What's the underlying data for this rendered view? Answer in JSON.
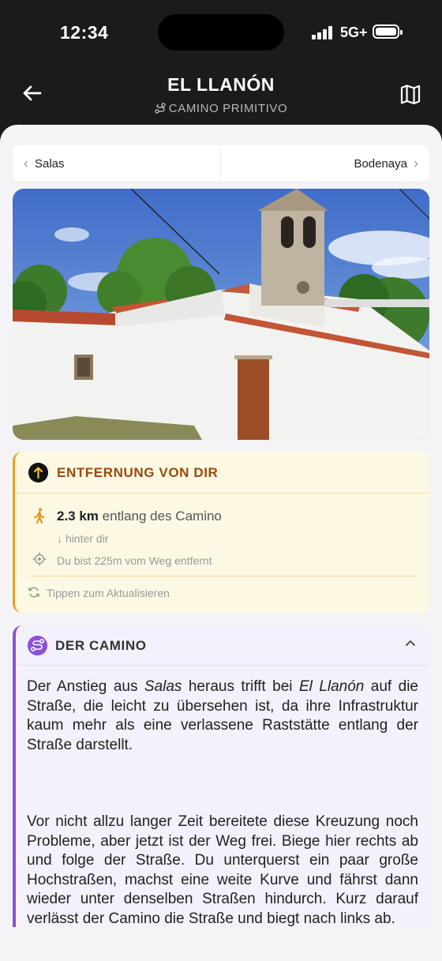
{
  "status_bar": {
    "time": "12:34",
    "network": "5G+"
  },
  "header": {
    "title": "EL LLANÓN",
    "subtitle": "CAMINO PRIMITIVO",
    "back_icon": "arrow-left-icon",
    "map_icon": "map-icon"
  },
  "nav": {
    "prev_label": "Salas",
    "next_label": "Bodenaya"
  },
  "distance_card": {
    "title": "ENTFERNUNG VON DIR",
    "distance": "2.3 km",
    "distance_suffix": "entlang des Camino",
    "direction": "↓ hinter dir",
    "off_path": "Du bist 225m vom Weg entfernt",
    "refresh": "Tippen zum Aktualisieren",
    "accent_color": "#e6a020",
    "title_color": "#9a4a0b"
  },
  "camino_card": {
    "title": "DER CAMINO",
    "accent_color": "#8a50d8",
    "paragraph1": {
      "t1": "Der Anstieg aus ",
      "em1": "Salas",
      "t2": " heraus trifft bei ",
      "em2": "El Llanón",
      "t3": " auf die Straße, die leicht zu übersehen ist, da ihre Infrastruktur kaum mehr als eine verlassene Raststätte entlang der Straße darstellt."
    },
    "paragraph2": "Vor nicht allzu langer Zeit bereitete diese Kreuzung noch Probleme, aber jetzt ist der Weg frei.  Biege hier rechts ab und folge der Straße.  Du unterquerst ein paar große Hochstraßen, machst eine weite Kurve und fährst dann wieder unter denselben Straßen hindurch. Kurz darauf verlässt der Camino die Straße und biegt nach links ab."
  }
}
